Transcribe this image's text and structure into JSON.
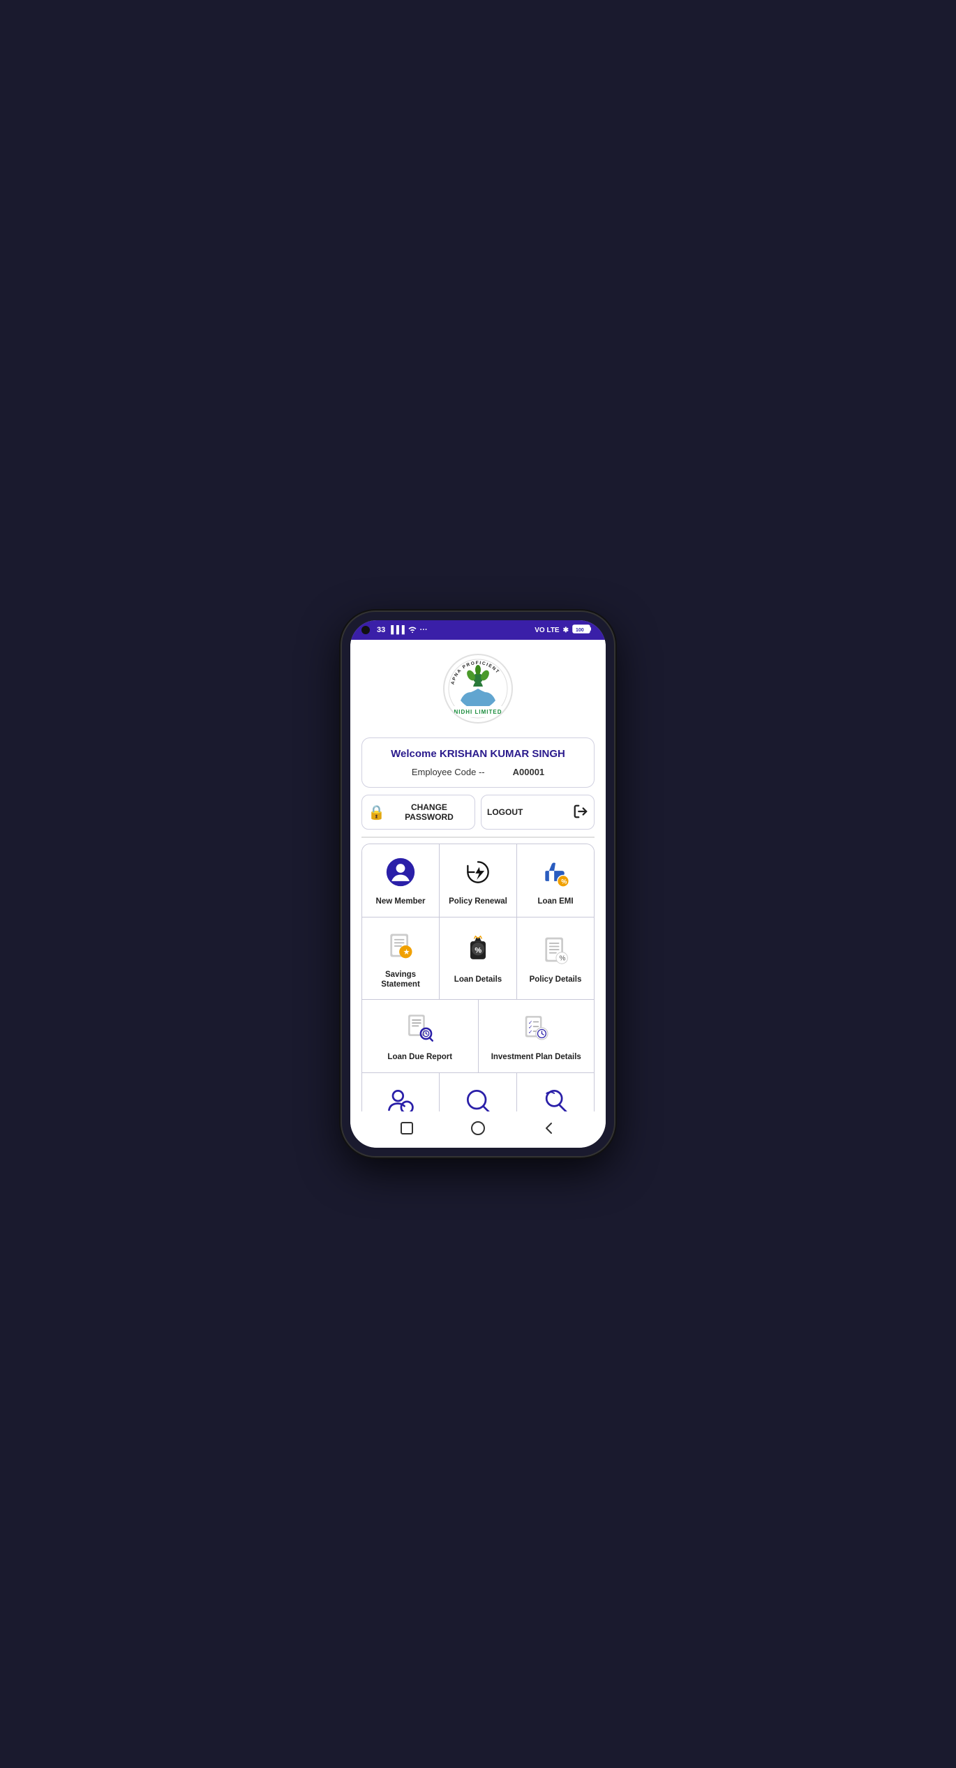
{
  "statusBar": {
    "time": "33",
    "signal": "signal",
    "wifi": "wifi",
    "vo": "VO",
    "lte": "LTE",
    "bluetooth": "BT",
    "battery": "100"
  },
  "logo": {
    "topText": "APNA PROFICIENT",
    "bottomText": "NIDHI LIMITED"
  },
  "welcome": {
    "title": "Welcome KRISHAN KUMAR SINGH",
    "employeeLabel": "Employee Code --",
    "employeeValue": "A00001"
  },
  "buttons": {
    "changePassword": "CHANGE PASSWORD",
    "logout": "LOGOUT"
  },
  "menu": {
    "row1": [
      {
        "id": "new-member",
        "label": "New Member",
        "icon": "person"
      },
      {
        "id": "policy-renewal",
        "label": "Policy Renewal",
        "icon": "renewal"
      },
      {
        "id": "loan-emi",
        "label": "Loan EMI",
        "icon": "loan-emi"
      }
    ],
    "row2": [
      {
        "id": "savings-statement",
        "label": "Savings Statement",
        "icon": "savings"
      },
      {
        "id": "loan-details",
        "label": "Loan Details",
        "icon": "loan-details"
      },
      {
        "id": "policy-details",
        "label": "Policy Details",
        "icon": "policy-details"
      }
    ],
    "row3": [
      {
        "id": "loan-due-report",
        "label": "Loan Due Report",
        "icon": "loan-due"
      },
      {
        "id": "investment-plan",
        "label": "Investment Plan Details",
        "icon": "investment"
      }
    ],
    "row4": [
      {
        "id": "search-person",
        "label": "",
        "icon": "search-person"
      },
      {
        "id": "search-main",
        "label": "",
        "icon": "search-main"
      },
      {
        "id": "search-alt",
        "label": "",
        "icon": "search-alt"
      }
    ]
  },
  "navBar": {
    "square": "□",
    "circle": "○",
    "back": "◁"
  }
}
